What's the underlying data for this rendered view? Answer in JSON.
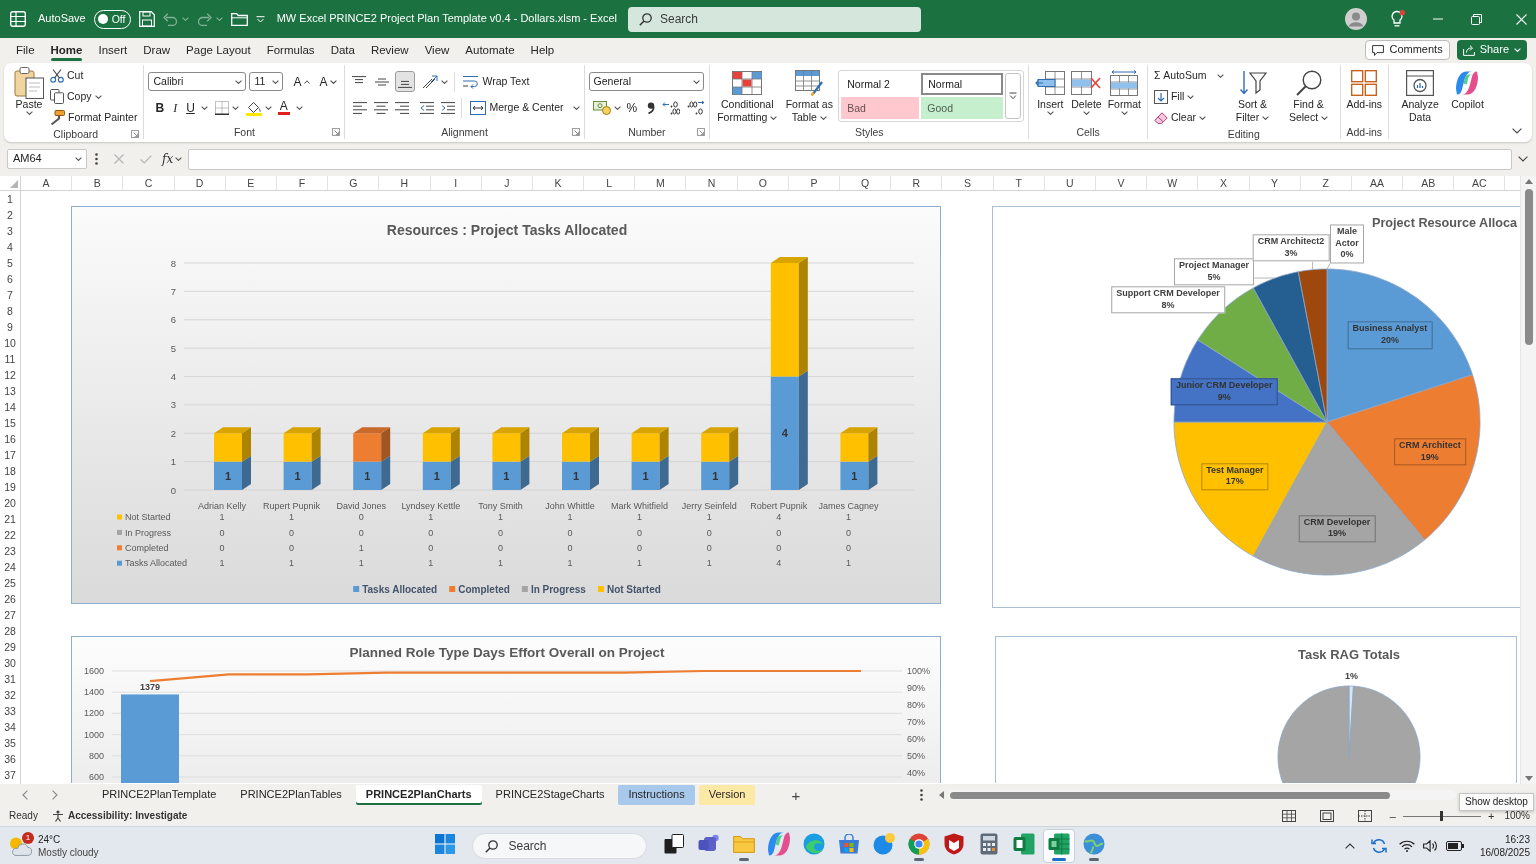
{
  "title_bar": {
    "autosave_label": "AutoSave",
    "autosave": {
      "on": false,
      "label": "Off"
    },
    "undo": {
      "disabled": true
    },
    "redo": {
      "disabled": true
    },
    "title": "MW Excel PRINCE2 Project Plan Template v0.4 - Dollars.xlsm - Excel",
    "search": {
      "placeholder": "Search"
    }
  },
  "menu": {
    "tabs": [
      {
        "label": "File",
        "selected": false
      },
      {
        "label": "Home",
        "selected": true
      },
      {
        "label": "Insert",
        "selected": false
      },
      {
        "label": "Draw",
        "selected": false
      },
      {
        "label": "Page Layout",
        "selected": false
      },
      {
        "label": "Formulas",
        "selected": false
      },
      {
        "label": "Data",
        "selected": false
      },
      {
        "label": "Review",
        "selected": false
      },
      {
        "label": "View",
        "selected": false
      },
      {
        "label": "Automate",
        "selected": false
      },
      {
        "label": "Help",
        "selected": false
      }
    ],
    "comments": "Comments",
    "share": "Share"
  },
  "ribbon": {
    "clipboard": {
      "label": "Clipboard",
      "paste": "Paste",
      "cut": "Cut",
      "copy": "Copy",
      "format_painter": "Format Painter"
    },
    "font": {
      "label": "Font",
      "family": "Calibri",
      "size": "11",
      "grow": "A",
      "shrink": "A",
      "bold": "B",
      "italic": "I",
      "underline": "U",
      "font_letter": "A"
    },
    "alignment": {
      "label": "Alignment",
      "vertical": [
        {
          "selected": false
        },
        {
          "selected": false
        },
        {
          "selected": true
        }
      ],
      "wrap_text": "Wrap Text",
      "merge_center": "Merge & Center"
    },
    "number": {
      "label": "Number",
      "format": "General",
      "percent": "%"
    },
    "styles": {
      "label": "Styles",
      "conditional_formatting": "Conditional Formatting",
      "format_as_table": "Format as Table",
      "gallery": [
        {
          "label": "Normal 2",
          "selected": false,
          "color": "#ffffff"
        },
        {
          "label": "Normal",
          "selected": true,
          "color": "#ffffff"
        },
        {
          "label": "Bad",
          "selected": false,
          "color": "#ffc7ce"
        },
        {
          "label": "Good",
          "selected": false,
          "color": "#c6efce"
        }
      ]
    },
    "cells": {
      "label": "Cells",
      "buttons": [
        "Insert",
        "Delete",
        "Format"
      ]
    },
    "editing": {
      "label": "Editing",
      "autosum": "Σ AutoSum",
      "fill": "Fill",
      "clear": "Clear",
      "sort_filter": "Sort & Filter",
      "find_select": "Find & Select"
    },
    "addins": {
      "label": "Add-ins",
      "button": "Add-ins"
    },
    "analyze_data": "Analyze Data",
    "copilot": "Copilot"
  },
  "formula_bar": {
    "name_box": "AM64",
    "cancel": {
      "disabled": true
    },
    "enter": {
      "disabled": true
    },
    "function": "fx"
  },
  "sheet": {
    "columns": [
      "A",
      "B",
      "C",
      "D",
      "E",
      "F",
      "G",
      "H",
      "I",
      "J",
      "K",
      "L",
      "M",
      "N",
      "O",
      "P",
      "Q",
      "R",
      "S",
      "T",
      "U",
      "V",
      "W",
      "X",
      "Y",
      "Z",
      "AA",
      "AB",
      "AC"
    ],
    "rows": [
      "1",
      "2",
      "3",
      "4",
      "5",
      "6",
      "7",
      "8",
      "9",
      "10",
      "11",
      "12",
      "13",
      "14",
      "15",
      "16",
      "17",
      "18",
      "19",
      "20",
      "21",
      "22",
      "23",
      "24",
      "25",
      "26",
      "27",
      "28",
      "29",
      "30",
      "31",
      "32",
      "33",
      "34",
      "35",
      "36",
      "37"
    ],
    "charts": [
      {
        "chart_data": {
          "type": "bar",
          "title": "Resources : Project Tasks Allocated",
          "stacked": true,
          "grid": true,
          "legend": "bottom",
          "categories": [
            "Adrian Kelly",
            "Rupert Pupnik",
            "David Jones",
            "Lyndsey Kettle",
            "Tony Smith",
            "John Whittle",
            "Mark Whitfield",
            "Jerry Seinfeld",
            "Robert Pupnik",
            "James Cagney"
          ],
          "ylim": [
            0,
            8
          ],
          "yticks": [
            0,
            1,
            2,
            3,
            4,
            5,
            6,
            7,
            8
          ],
          "series": [
            {
              "name": "Tasks Allocated",
              "color": "#5b9bd5",
              "values": [
                1,
                1,
                1,
                1,
                1,
                1,
                1,
                1,
                4,
                1
              ],
              "value_labels": [
                "1",
                "1",
                "1",
                "1",
                "1",
                "1",
                "1",
                "1",
                "4",
                "1"
              ]
            },
            {
              "name": "Completed",
              "color": "#ed7d31",
              "values": [
                0,
                0,
                1,
                0,
                0,
                0,
                0,
                0,
                0,
                0
              ]
            },
            {
              "name": "In Progress",
              "color": "#a5a5a5",
              "values": [
                0,
                0,
                0,
                0,
                0,
                0,
                0,
                0,
                0,
                0
              ]
            },
            {
              "name": "Not Started",
              "color": "#ffc000",
              "values": [
                1,
                1,
                0,
                1,
                1,
                1,
                1,
                1,
                4,
                1
              ]
            }
          ]
        },
        "data_table": {
          "rows": [
            {
              "label": "Not Started",
              "color": "#ffc000",
              "cells": [
                "1",
                "1",
                "0",
                "1",
                "1",
                "1",
                "1",
                "1",
                "4",
                "1"
              ]
            },
            {
              "label": "In Progress",
              "color": "#a5a5a5",
              "cells": [
                "0",
                "0",
                "0",
                "0",
                "0",
                "0",
                "0",
                "0",
                "0",
                "0"
              ]
            },
            {
              "label": "Completed",
              "color": "#ed7d31",
              "cells": [
                "0",
                "0",
                "1",
                "0",
                "0",
                "0",
                "0",
                "0",
                "0",
                "0"
              ]
            },
            {
              "label": "Tasks Allocated",
              "color": "#5b9bd5",
              "cells": [
                "1",
                "1",
                "1",
                "1",
                "1",
                "1",
                "1",
                "1",
                "4",
                "1"
              ]
            }
          ]
        }
      },
      {
        "chart_data": {
          "type": "pie",
          "title": "Project Resource Alloca",
          "categories": [
            "Business Analyst",
            "CRM Architect",
            "CRM Developer",
            "Test Manager",
            "Junior CRM Developer",
            "Support CRM Developer",
            "Project Manager",
            "CRM Architect2",
            "Male Actor"
          ],
          "values": [
            20,
            19,
            19,
            17,
            9,
            8,
            5,
            3,
            0
          ],
          "colors": [
            "#5b9bd5",
            "#ed7d31",
            "#a5a5a5",
            "#ffc000",
            "#4472c4",
            "#70ad47",
            "#255e91",
            "#9e480e",
            null
          ],
          "value_labels": [
            "20%",
            "19%",
            "19%",
            "17%",
            "9%",
            "8%",
            "5%",
            "3%",
            "0%"
          ]
        }
      },
      {
        "chart_data": {
          "type": "bar",
          "title": "Planned Role Type Days Effort Overall on Project",
          "grid": true,
          "ylim": [
            534,
            1600
          ],
          "yticks": [
            600,
            800,
            1000,
            1200,
            1400,
            1600
          ],
          "y2lim": [
            0,
            1
          ],
          "y2ticks": [
            {
              "value": 0.4,
              "label": "40%"
            },
            {
              "value": 0.5,
              "label": "50%"
            },
            {
              "value": 0.6,
              "label": "60%"
            },
            {
              "value": 0.7,
              "label": "70%"
            },
            {
              "value": 0.8,
              "label": "80%"
            },
            {
              "value": 0.9,
              "label": "90%"
            },
            {
              "value": 1,
              "label": "100%"
            }
          ],
          "series": [
            {
              "type": "bar",
              "color": "#5b9bd5",
              "values": [
                1379
              ],
              "value_labels": [
                "1379"
              ]
            },
            {
              "type": "line",
              "axis": "y2",
              "color": "#ed7d31",
              "values": [
                0.94,
                0.98,
                0.98,
                0.99,
                0.99,
                0.99,
                0.99,
                1,
                1,
                1
              ]
            }
          ]
        }
      },
      {
        "chart_data": {
          "type": "pie",
          "title": "Task RAG Totals",
          "values": [
            1,
            99
          ],
          "colors": [
            "#d6e6f4",
            "#a5a5a5"
          ],
          "value_labels": [
            "1%",
            null
          ]
        }
      }
    ]
  },
  "sheet_tabs": {
    "tabs": [
      {
        "label": "PRINCE2PlanTemplate",
        "selected": false
      },
      {
        "label": "PRINCE2PlanTables",
        "selected": false
      },
      {
        "label": "PRINCE2PlanCharts",
        "selected": true
      },
      {
        "label": "PRINCE2StageCharts",
        "selected": false
      },
      {
        "label": "Instructions",
        "selected": false,
        "color": "#a9c9ec"
      },
      {
        "label": "Version",
        "selected": false,
        "color": "#fde9a6"
      }
    ],
    "add": "+"
  },
  "status_bar": {
    "ready": "Ready",
    "accessibility": "Accessibility: Investigate",
    "zoom_out": "–",
    "zoom_slider": {
      "level": 0.5
    },
    "zoom_in": "+",
    "zoom": "100%"
  },
  "tooltip": "Show desktop",
  "taskbar": {
    "weather": {
      "badge": "1",
      "temperature": "24°C",
      "condition": "Mostly cloudy"
    },
    "search": {
      "placeholder": "Search"
    },
    "apps": [
      {
        "running": false,
        "selected": false
      },
      {
        "running": false,
        "selected": false
      },
      {
        "running": true,
        "selected": false
      },
      {
        "running": false,
        "selected": false
      },
      {
        "running": false,
        "selected": false
      },
      {
        "running": false,
        "selected": false
      },
      {
        "running": false,
        "selected": false
      },
      {
        "running": true,
        "selected": false
      },
      {
        "running": false,
        "selected": false
      },
      {
        "running": false,
        "selected": false
      },
      {
        "running": false,
        "selected": false
      },
      {
        "running": true,
        "selected": true
      },
      {
        "running": true,
        "selected": false
      }
    ],
    "time": "16:23",
    "date": "16/08/2025"
  }
}
